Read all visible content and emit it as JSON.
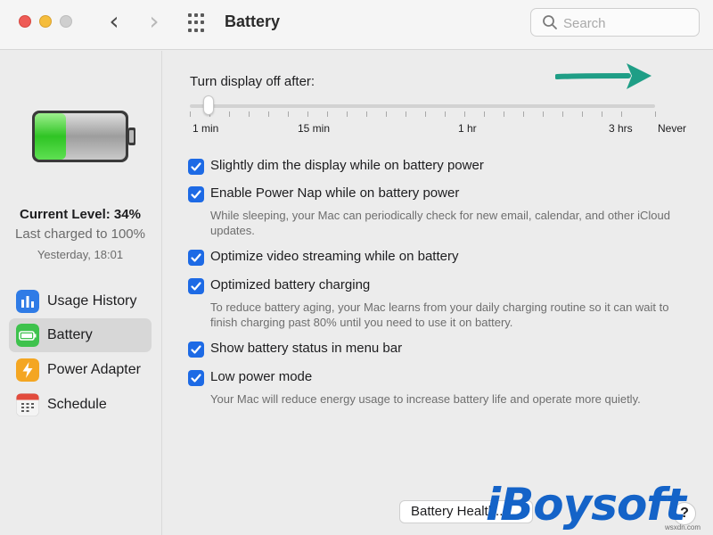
{
  "window": {
    "title": "Battery",
    "traffic_lights": [
      "close",
      "minimize",
      "zoom"
    ]
  },
  "toolbar": {
    "back_icon": "‹",
    "forward_icon": "›",
    "search_placeholder": "Search"
  },
  "sidebar": {
    "current_level": "Current Level: 34%",
    "last_charged": "Last charged to 100%",
    "charged_time": "Yesterday, 18:01",
    "battery_fill_fraction": 0.34,
    "items": [
      {
        "label": "Usage History",
        "icon": "bar-chart-icon",
        "selected": false
      },
      {
        "label": "Battery",
        "icon": "battery-icon",
        "selected": true
      },
      {
        "label": "Power Adapter",
        "icon": "bolt-icon",
        "selected": false
      },
      {
        "label": "Schedule",
        "icon": "calendar-icon",
        "selected": false
      }
    ]
  },
  "display_slider": {
    "label": "Turn display off after:",
    "ticks": [
      "1 min",
      "15 min",
      "1 hr",
      "3 hrs",
      "Never"
    ],
    "value": "1 min"
  },
  "options": [
    {
      "label": "Slightly dim the display while on battery power",
      "checked": true,
      "description": ""
    },
    {
      "label": "Enable Power Nap while on battery power",
      "checked": true,
      "description": "While sleeping, your Mac can periodically check for new email, calendar, and other iCloud updates."
    },
    {
      "label": "Optimize video streaming while on battery",
      "checked": true,
      "description": ""
    },
    {
      "label": "Optimized battery charging",
      "checked": true,
      "description": "To reduce battery aging, your Mac learns from your daily charging routine so it can wait to finish charging past 80% until you need to use it on battery."
    },
    {
      "label": "Show battery status in menu bar",
      "checked": true,
      "description": ""
    },
    {
      "label": "Low power mode",
      "checked": true,
      "description": "Your Mac will reduce energy usage to increase battery life and operate more quietly."
    }
  ],
  "footer": {
    "battery_health_button": "Battery Health...",
    "help_button": "?"
  },
  "watermark": {
    "text": "iBoysoft",
    "site": "wsxdn.com"
  },
  "colors": {
    "accent": "#1d6ae5",
    "battery_green": "#38d12f",
    "arrow": "#1f9e86",
    "watermark": "#1463c8"
  }
}
